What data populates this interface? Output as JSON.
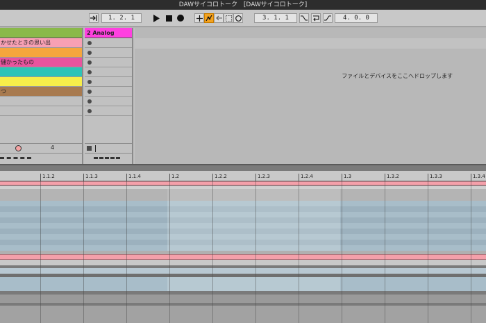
{
  "window": {
    "title": "DAWサイコロトーク",
    "subtitle": "[DAWサイコロトーク]"
  },
  "transport": {
    "position": "1.  2.  1",
    "loop_start": "3.  1.  1",
    "loop_length": "4.  0.  0"
  },
  "tracks": [
    {
      "color": "#8ab94a",
      "clips": [
        {
          "label": "かせたときの思い出",
          "color": "#f7a0b4"
        },
        {
          "label": "",
          "color": "#f5a63d"
        },
        {
          "label": "儲かったもの",
          "color": "#e8549e"
        },
        {
          "label": "",
          "color": "#2ec3b7"
        },
        {
          "label": "",
          "color": "#f7ee4a"
        },
        {
          "label": "つ",
          "color": "#a87a4f"
        },
        {
          "label": "",
          "color": "#c1c1c1"
        },
        {
          "label": "",
          "color": "#c1c1c1"
        }
      ],
      "number": "4"
    },
    {
      "name": "2 Analog",
      "color": "#ff40e0",
      "slot_count": 8
    }
  ],
  "dropzone": {
    "text": "ファイルとデバイスをここへドロップします"
  },
  "ruler": [
    "1.1.2",
    "1.1.3",
    "1.1.4",
    "1.2",
    "1.2.2",
    "1.2.3",
    "1.2.4",
    "1.3",
    "1.3.2",
    "1.3.3",
    "1.3.4"
  ],
  "colors": {
    "accent": "#f3a21f",
    "clip_lane": "#a7bcc8",
    "loop_region": "#bfd0da",
    "pink_lane": "#f4a0aa"
  },
  "icons": [
    "follow-icon",
    "play-icon",
    "stop-icon",
    "record-icon",
    "overdub-icon",
    "automation-arm-icon",
    "back-to-arrangement-icon",
    "session-record-icon",
    "loop-switch-icon",
    "punch-in-icon",
    "punch-out-icon"
  ]
}
